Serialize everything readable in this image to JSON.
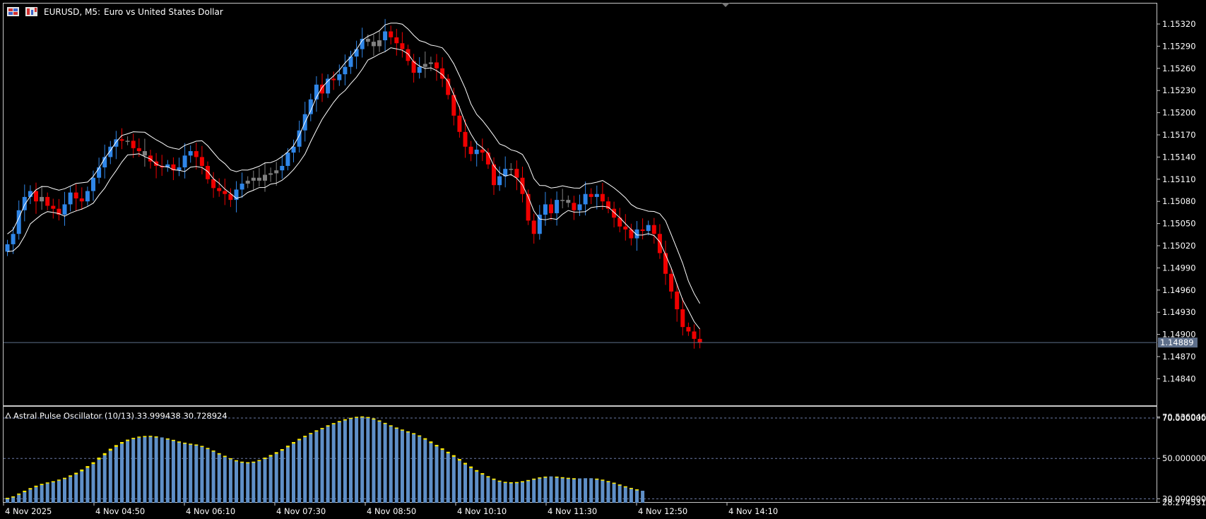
{
  "window": {
    "symbol_label": "EURUSD, M5:",
    "description": "Euro vs United States Dollar",
    "icons": [
      "chart-grid-icon",
      "candles-icon"
    ]
  },
  "colors": {
    "background": "#000000",
    "bull": "#2F86E8",
    "bear": "#F00000",
    "neutral": "#808080",
    "ma_line": "#FFFFFF",
    "bid_line": "#5E6F8A",
    "osc_bar": "#5F8FC7",
    "osc_cap": "#FFEA00",
    "axis_text": "#FFFFFF"
  },
  "price_axis": {
    "labels": [
      "1.15320",
      "1.15290",
      "1.15260",
      "1.15230",
      "1.15200",
      "1.15170",
      "1.15140",
      "1.15110",
      "1.15080",
      "1.15050",
      "1.15020",
      "1.14990",
      "1.14960",
      "1.14930",
      "1.14900",
      "1.14870",
      "1.14840"
    ],
    "current_price": "1.14889"
  },
  "time_axis": {
    "labels": [
      "4 Nov 2025",
      "4 Nov 04:50",
      "4 Nov 06:10",
      "4 Nov 07:30",
      "4 Nov 08:50",
      "4 Nov 10:10",
      "4 Nov 11:30",
      "4 Nov 12:50",
      "4 Nov 14:10"
    ]
  },
  "indicator": {
    "title": "Astral Pulse Oscillator (10/13) 33.999438 30.728924",
    "levels": [
      70.0,
      50.0,
      30.0
    ],
    "axis_labels": [
      "70.536046",
      "70.000000",
      "50.000000",
      "30.000000",
      "28.274531"
    ]
  },
  "chart_data": {
    "type": "candlestick",
    "ylim": [
      1.1481,
      1.1536
    ],
    "closes": [
      1.15022,
      1.15036,
      1.15068,
      1.15086,
      1.15094,
      1.1508,
      1.15086,
      1.15074,
      1.1507,
      1.15062,
      1.15076,
      1.15092,
      1.15084,
      1.1508,
      1.15094,
      1.15112,
      1.15126,
      1.1514,
      1.15154,
      1.15164,
      1.15162,
      1.15162,
      1.15152,
      1.15148,
      1.15142,
      1.15134,
      1.15128,
      1.15126,
      1.1513,
      1.15122,
      1.15126,
      1.15142,
      1.15148,
      1.1514,
      1.15128,
      1.1511,
      1.15098,
      1.15094,
      1.1509,
      1.15082,
      1.15096,
      1.15104,
      1.15108,
      1.15112,
      1.15108,
      1.15116,
      1.15118,
      1.15122,
      1.15128,
      1.15146,
      1.15154,
      1.15176,
      1.15198,
      1.15218,
      1.15238,
      1.15226,
      1.15246,
      1.15244,
      1.15252,
      1.15262,
      1.15276,
      1.15286,
      1.153,
      1.15296,
      1.1529,
      1.15298,
      1.1531,
      1.15302,
      1.15294,
      1.15286,
      1.1527,
      1.15254,
      1.15262,
      1.15266,
      1.15268,
      1.1526,
      1.15246,
      1.15224,
      1.15196,
      1.15174,
      1.15154,
      1.15144,
      1.1515,
      1.15146,
      1.1513,
      1.15102,
      1.15114,
      1.15124,
      1.15124,
      1.15112,
      1.1509,
      1.15054,
      1.15036,
      1.15062,
      1.15076,
      1.15064,
      1.15082,
      1.15082,
      1.15078,
      1.15068,
      1.15076,
      1.1509,
      1.15086,
      1.1509,
      1.1508,
      1.1507,
      1.15058,
      1.15046,
      1.15042,
      1.1503,
      1.15042,
      1.1504,
      1.15048,
      1.15036,
      1.1501,
      1.14982,
      1.14958,
      1.14934,
      1.1491,
      1.14904,
      1.14894,
      1.14889
    ],
    "oscillator": [
      30.5,
      31.2,
      32.6,
      34.0,
      35.3,
      36.5,
      37.4,
      38.1,
      38.7,
      39.5,
      40.4,
      41.6,
      42.9,
      44.5,
      46.2,
      48.1,
      50.4,
      52.6,
      54.8,
      56.6,
      58.1,
      59.3,
      60.2,
      60.8,
      61.1,
      61.2,
      60.9,
      60.4,
      59.8,
      59.0,
      58.2,
      57.6,
      57.2,
      56.7,
      55.9,
      54.8,
      53.4,
      52.0,
      50.7,
      49.6,
      48.7,
      48.1,
      48.0,
      48.4,
      49.2,
      50.4,
      51.7,
      53.1,
      54.6,
      56.3,
      58.1,
      59.7,
      61.2,
      62.6,
      63.9,
      65.1,
      66.4,
      67.5,
      68.5,
      69.4,
      70.1,
      70.6,
      70.8,
      70.5,
      69.7,
      68.5,
      67.2,
      66.0,
      65.0,
      64.1,
      63.2,
      62.2,
      60.9,
      59.3,
      57.6,
      55.9,
      54.2,
      52.5,
      50.8,
      48.9,
      47.0,
      45.2,
      43.5,
      42.0,
      40.6,
      39.4,
      38.6,
      38.2,
      38.1,
      38.3,
      38.7,
      39.3,
      40.0,
      40.6,
      41.0,
      41.1,
      40.9,
      40.5,
      40.2,
      40.1,
      40.1,
      40.2,
      40.2,
      39.9,
      39.3,
      38.6,
      37.8,
      36.9,
      36.0,
      35.2,
      34.6,
      34.0
    ],
    "signal": [
      30.3,
      30.9,
      32.0,
      33.3,
      34.6,
      35.8,
      36.8,
      37.6,
      38.3,
      39.0,
      39.8,
      40.9,
      42.1,
      43.6,
      45.3,
      47.2,
      49.4,
      51.6,
      53.8,
      55.7,
      57.3,
      58.6,
      59.6,
      60.3,
      60.7,
      60.9,
      60.8,
      60.4,
      59.9,
      59.2,
      58.4,
      57.8,
      57.3,
      56.9,
      56.2,
      55.2,
      53.9,
      52.6,
      51.3,
      50.1,
      49.1,
      48.4,
      48.1,
      48.2,
      48.7,
      49.7,
      50.9,
      52.3,
      53.8,
      55.5,
      57.3,
      59.0,
      60.5,
      62.0,
      63.3,
      64.5,
      65.8,
      66.9,
      67.9,
      68.8,
      69.6,
      70.2,
      70.5,
      70.4,
      69.8,
      68.8,
      67.6,
      66.4,
      65.3,
      64.3,
      63.4,
      62.5,
      61.4,
      60.0,
      58.4,
      56.7,
      55.0,
      53.3,
      51.6,
      49.7,
      47.8,
      46.0,
      44.2,
      42.7,
      41.2,
      40.0,
      39.0,
      38.4,
      38.2,
      38.2,
      38.5,
      39.1,
      39.7,
      40.4,
      40.9,
      41.1,
      41.0,
      40.7,
      40.4,
      40.2,
      40.1,
      40.2,
      40.2,
      40.0,
      39.5,
      38.8,
      38.0,
      37.1,
      36.2,
      35.4,
      34.7,
      34.0
    ]
  }
}
